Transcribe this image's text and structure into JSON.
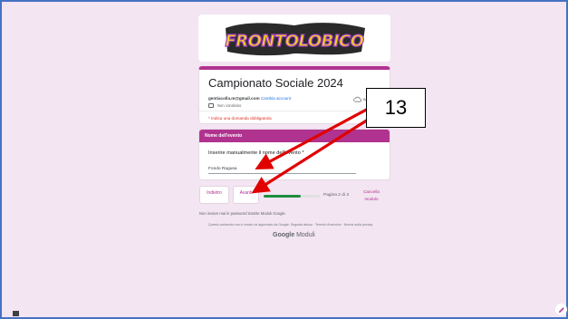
{
  "banner": {
    "logo_text": "FRONTOLOBICO"
  },
  "header": {
    "title": "Campionato Sociale 2024",
    "email": "gentiacolla.m@gmail.com",
    "switch_account": "Cambia account",
    "share_text": "Non condiviso",
    "saved_text": "Bozza",
    "required_notice": "* Indica una domanda obbligatoria"
  },
  "section": {
    "title": "Nome dell'evento",
    "question": "Inserire manualmente il nome dell'evento *",
    "answer": "Fondo Ragusa"
  },
  "nav": {
    "back": "Indietro",
    "next": "Avanti",
    "progress": 0.66,
    "page_label": "Pagina 2 di 3",
    "clear": "Cancella modulo"
  },
  "footer": {
    "note": "Non inviare mai le password tramite Moduli Google.",
    "legal": "Questo contenuto non è creato né approvato da Google. Segnala abuso · Termini di servizio · Norme sulla privacy",
    "brand_google": "Google",
    "brand_product": "Moduli"
  },
  "annotation": {
    "label": "13",
    "color": "#e00000"
  },
  "colors": {
    "accent": "#b0338f",
    "progress": "#1e8e3e",
    "frame_border": "#4472c4",
    "page_bg": "#f3e5f2"
  }
}
